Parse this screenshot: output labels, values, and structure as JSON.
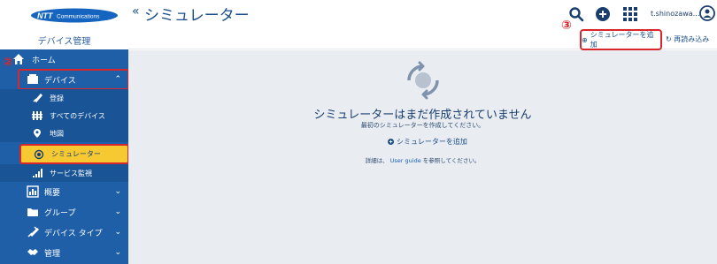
{
  "brand": {
    "logo_text": "NTT Communications",
    "subtitle": "デバイス管理"
  },
  "header": {
    "collapse": "«",
    "title": "シミュレーター",
    "username": "t.shinozawa…"
  },
  "toolbar": {
    "add_label": "シミュレーターを追加",
    "reload_label": "再読み込み"
  },
  "annotations": {
    "two": "②",
    "three": "③"
  },
  "sidebar": {
    "home": "ホーム",
    "devices": "デバイス",
    "sub": {
      "register": "登録",
      "all": "すべてのデバイス",
      "map": "地図",
      "simulator": "シミュレーター",
      "service": "サービス監視"
    },
    "overview": "概要",
    "groups": "グループ",
    "device_types": "デバイス タイプ",
    "admin": "管理"
  },
  "empty": {
    "title": "シミュレーターはまだ作成されていません",
    "subtitle": "最初のシミュレーターを作成してください。",
    "add_label": "シミュレーターを追加",
    "detail_prefix": "詳細は、",
    "detail_link": "User guide",
    "detail_suffix": " を参照してください。"
  },
  "colors": {
    "sidebar": "#1f5fa8",
    "accent": "#1a4e8a",
    "highlight": "#f6c933",
    "annotation": "#d9262c"
  }
}
